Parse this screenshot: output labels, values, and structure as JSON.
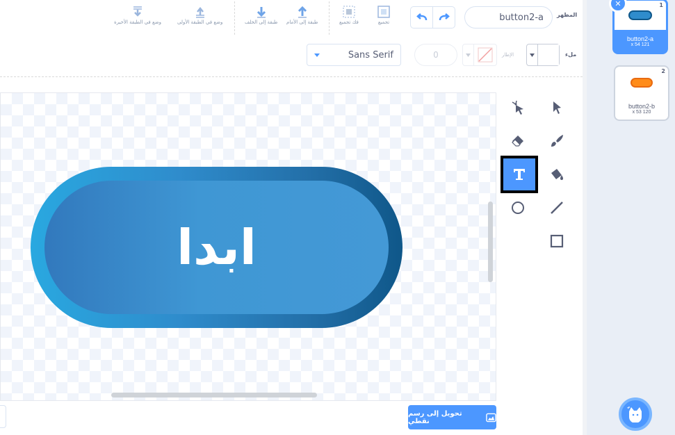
{
  "toolbar": {
    "costume_label": "المظهر",
    "costume_name": "button2-a",
    "undo_icon": "undo-icon",
    "redo_icon": "redo-icon",
    "group_label": "تجميع",
    "ungroup_label": "فك تجميع",
    "forward_label": "طبقة إلى الأمام",
    "backward_label": "طبقة إلى الخلف",
    "front_label": "وضع في الطبقة الأولى",
    "back_label": "وضع في الطبقة الأخيرة"
  },
  "props": {
    "fill_label": "ملء",
    "outline_label": "الإطار",
    "outline_width": "0",
    "font": "Sans Serif"
  },
  "canvas": {
    "button_text": "ابدا",
    "colors": {
      "outer_left": "#29a8e0",
      "outer_right": "#0f5789",
      "inner": "#4499d6"
    }
  },
  "tools": [
    "reshape-tool",
    "select-tool",
    "eraser-tool",
    "brush-tool",
    "text-tool",
    "fill-tool",
    "circle-tool",
    "line-tool",
    "rectangle-tool"
  ],
  "active_tool": "text-tool",
  "convert_button": "تحويل إلى رسم نقطي",
  "costumes": [
    {
      "number": "1",
      "name": "button2-a",
      "size": "x 54 121",
      "thumb_color": "#2f8ccc"
    },
    {
      "number": "2",
      "name": "button2-b",
      "size": "x 53 120",
      "thumb_color": "#ff8c1a"
    }
  ],
  "accent_color": "#4c97ff"
}
